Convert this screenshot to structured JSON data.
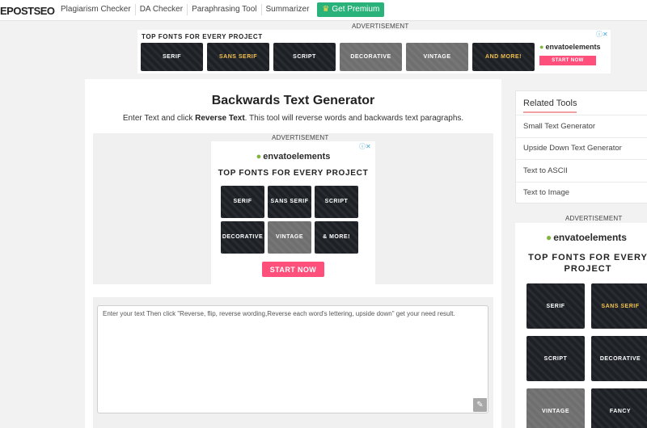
{
  "header": {
    "logo": "EPOSTSEO",
    "nav": [
      "Plagiarism Checker",
      "DA Checker",
      "Paraphrasing Tool",
      "Summarizer"
    ],
    "premium_label": "Get Premium",
    "premium_icon": "crown-icon"
  },
  "ads": {
    "label": "ADVERTISEMENT",
    "banner": {
      "headline": "TOP FONTS FOR EVERY PROJECT",
      "tiles": [
        "SERIF",
        "SANS SERIF",
        "SCRIPT",
        "DECORATIVE",
        "VINTAGE",
        "AND MORE!"
      ],
      "brand": "envatoelements",
      "cta": "START NOW"
    },
    "inner": {
      "brand": "envatoelements",
      "headline": "TOP FONTS FOR EVERY PROJECT",
      "tiles": [
        "SERIF",
        "SANS SERIF",
        "SCRIPT",
        "DECORATIVE",
        "VINTAGE",
        "& MORE!"
      ],
      "cta": "START NOW"
    },
    "side": {
      "brand": "envatoelements",
      "headline": "TOP FONTS FOR EVERY PROJECT",
      "tiles": [
        "SERIF",
        "SANS SERIF",
        "SCRIPT",
        "DECORATIVE",
        "VINTAGE",
        "FANCY"
      ]
    }
  },
  "main": {
    "title": "Backwards Text Generator",
    "desc_before": "Enter Text and click ",
    "desc_bold": "Reverse Text",
    "desc_after": ". This tool will reverse words and backwards text paragraphs.",
    "editor_placeholder": "Enter your text Then click \"Reverse, flip, reverse wording,Reverse each word's lettering, upside down\" get your need result."
  },
  "sidebar": {
    "title": "Related Tools",
    "items": [
      "Small Text Generator",
      "Upside Down Text Generator",
      "Text to ASCII",
      "Text to Image"
    ]
  },
  "colors": {
    "premium": "#2ab27b",
    "cta": "#ff4f7b",
    "envato_leaf": "#82b440"
  }
}
